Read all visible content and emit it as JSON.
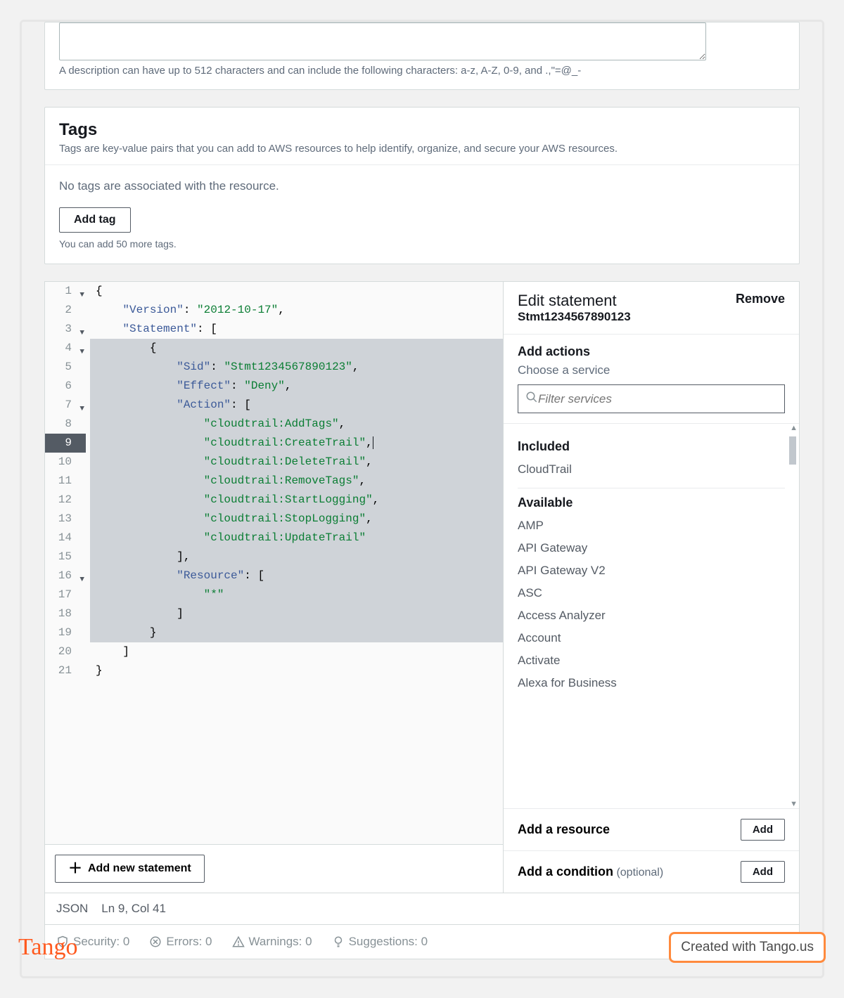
{
  "description": {
    "helper": "A description can have up to 512 characters and can include the following characters: a-z, A-Z, 0-9, and .,\"=@_-"
  },
  "tags": {
    "title": "Tags",
    "desc": "Tags are key-value pairs that you can add to AWS resources to help identify, organize, and secure your AWS resources.",
    "empty": "No tags are associated with the resource.",
    "add_btn": "Add tag",
    "limit": "You can add 50 more tags."
  },
  "editor": {
    "raw": {
      "Version": "2012-10-17",
      "Statement": [
        {
          "Sid": "Stmt1234567890123",
          "Effect": "Deny",
          "Action": [
            "cloudtrail:AddTags",
            "cloudtrail:CreateTrail",
            "cloudtrail:DeleteTrail",
            "cloudtrail:RemoveTags",
            "cloudtrail:StartLogging",
            "cloudtrail:StopLogging",
            "cloudtrail:UpdateTrail"
          ],
          "Resource": [
            "*"
          ]
        }
      ]
    },
    "add_statement_btn": "Add new statement",
    "status": {
      "mode": "JSON",
      "pos": "Ln 9, Col 41"
    },
    "validation": {
      "security": "Security: 0",
      "errors": "Errors: 0",
      "warnings": "Warnings: 0",
      "suggestions": "Suggestions: 0"
    }
  },
  "sidebar": {
    "edit_title": "Edit statement",
    "stmt_id": "Stmt1234567890123",
    "remove": "Remove",
    "add_actions": "Add actions",
    "choose_service": "Choose a service",
    "filter_placeholder": "Filter services",
    "included_hdr": "Included",
    "included": [
      "CloudTrail"
    ],
    "available_hdr": "Available",
    "available": [
      "AMP",
      "API Gateway",
      "API Gateway V2",
      "ASC",
      "Access Analyzer",
      "Account",
      "Activate",
      "Alexa for Business"
    ],
    "add_resource": "Add a resource",
    "add_condition": "Add a condition",
    "optional": "(optional)",
    "add_btn": "Add"
  },
  "footer": {
    "logo": "Tango",
    "badge": "Created with Tango.us"
  }
}
